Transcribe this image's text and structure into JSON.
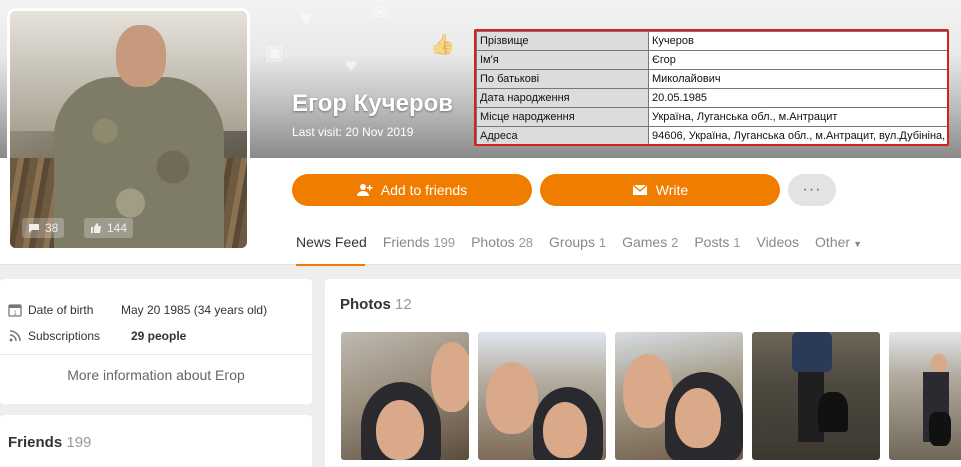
{
  "profile": {
    "name": "Егор Кучеров",
    "last_visit": "Last visit: 20 Nov 2019",
    "avatar_stats": {
      "comments": "38",
      "likes": "144"
    }
  },
  "info_table": [
    {
      "key": "Прізвище",
      "value": "Кучеров"
    },
    {
      "key": "Ім'я",
      "value": "Єгор"
    },
    {
      "key": "По батькові",
      "value": "Миколайович"
    },
    {
      "key": "Дата народження",
      "value": "20.05.1985"
    },
    {
      "key": "Місце народження",
      "value": "Україна, Луганська обл., м.Антрацит"
    },
    {
      "key": "Адреса",
      "value": "94606, Україна, Луганська обл., м.Антрацит, вул.Дубініна,"
    }
  ],
  "actions": {
    "add_friend": "Add to friends",
    "write": "Write",
    "more": "···"
  },
  "tabs": [
    {
      "label": "News Feed",
      "count": ""
    },
    {
      "label": "Friends",
      "count": "199"
    },
    {
      "label": "Photos",
      "count": "28"
    },
    {
      "label": "Groups",
      "count": "1"
    },
    {
      "label": "Games",
      "count": "2"
    },
    {
      "label": "Posts",
      "count": "1"
    },
    {
      "label": "Videos",
      "count": ""
    },
    {
      "label": "Other",
      "count": ""
    }
  ],
  "about": {
    "dob_label": "Date of birth",
    "dob_value": "May 20 1985 (34 years old)",
    "subs_label": "Subscriptions",
    "subs_value": "29 people",
    "more_info": "More information about Егор"
  },
  "friends": {
    "title": "Friends",
    "count": "199"
  },
  "photos": {
    "title": "Photos",
    "count": "12"
  },
  "colors": {
    "accent": "#f07d00",
    "highlight_border": "#d81e1e"
  }
}
